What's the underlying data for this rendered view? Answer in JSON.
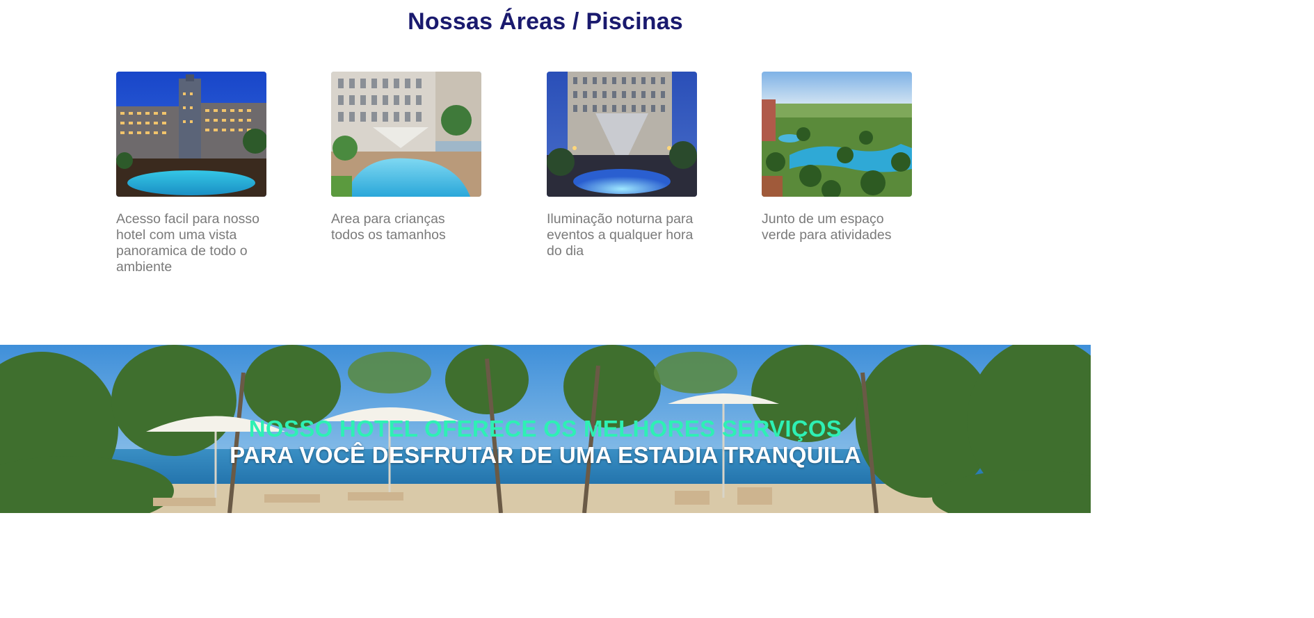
{
  "section": {
    "title": "Nossas Áreas / Piscinas"
  },
  "cards": [
    {
      "image": "hotel-pool-night-photo",
      "text": "Acesso facil para nosso hotel com uma vista panoramica de todo o ambiente"
    },
    {
      "image": "kids-pool-photo",
      "text": "Area para crianças todos os tamanhos"
    },
    {
      "image": "night-lighting-pool-photo",
      "text": "Iluminação noturna para eventos a qualquer hora do dia"
    },
    {
      "image": "green-area-pool-photo",
      "text": "Junto de um espaço verde para atividades"
    }
  ],
  "banner": {
    "image": "beach-resort-photo",
    "line1": "NOSSO HOTEL OFERECE OS MELHORES SERVIÇOS",
    "line2": "PARA VOCÊ DESFRUTAR DE UMA ESTADIA TRANQUILA"
  },
  "colors": {
    "title": "#1a1a6e",
    "text": "#7a7a7a",
    "banner_line1": "#2ef0b4",
    "banner_line2": "#ffffff"
  }
}
